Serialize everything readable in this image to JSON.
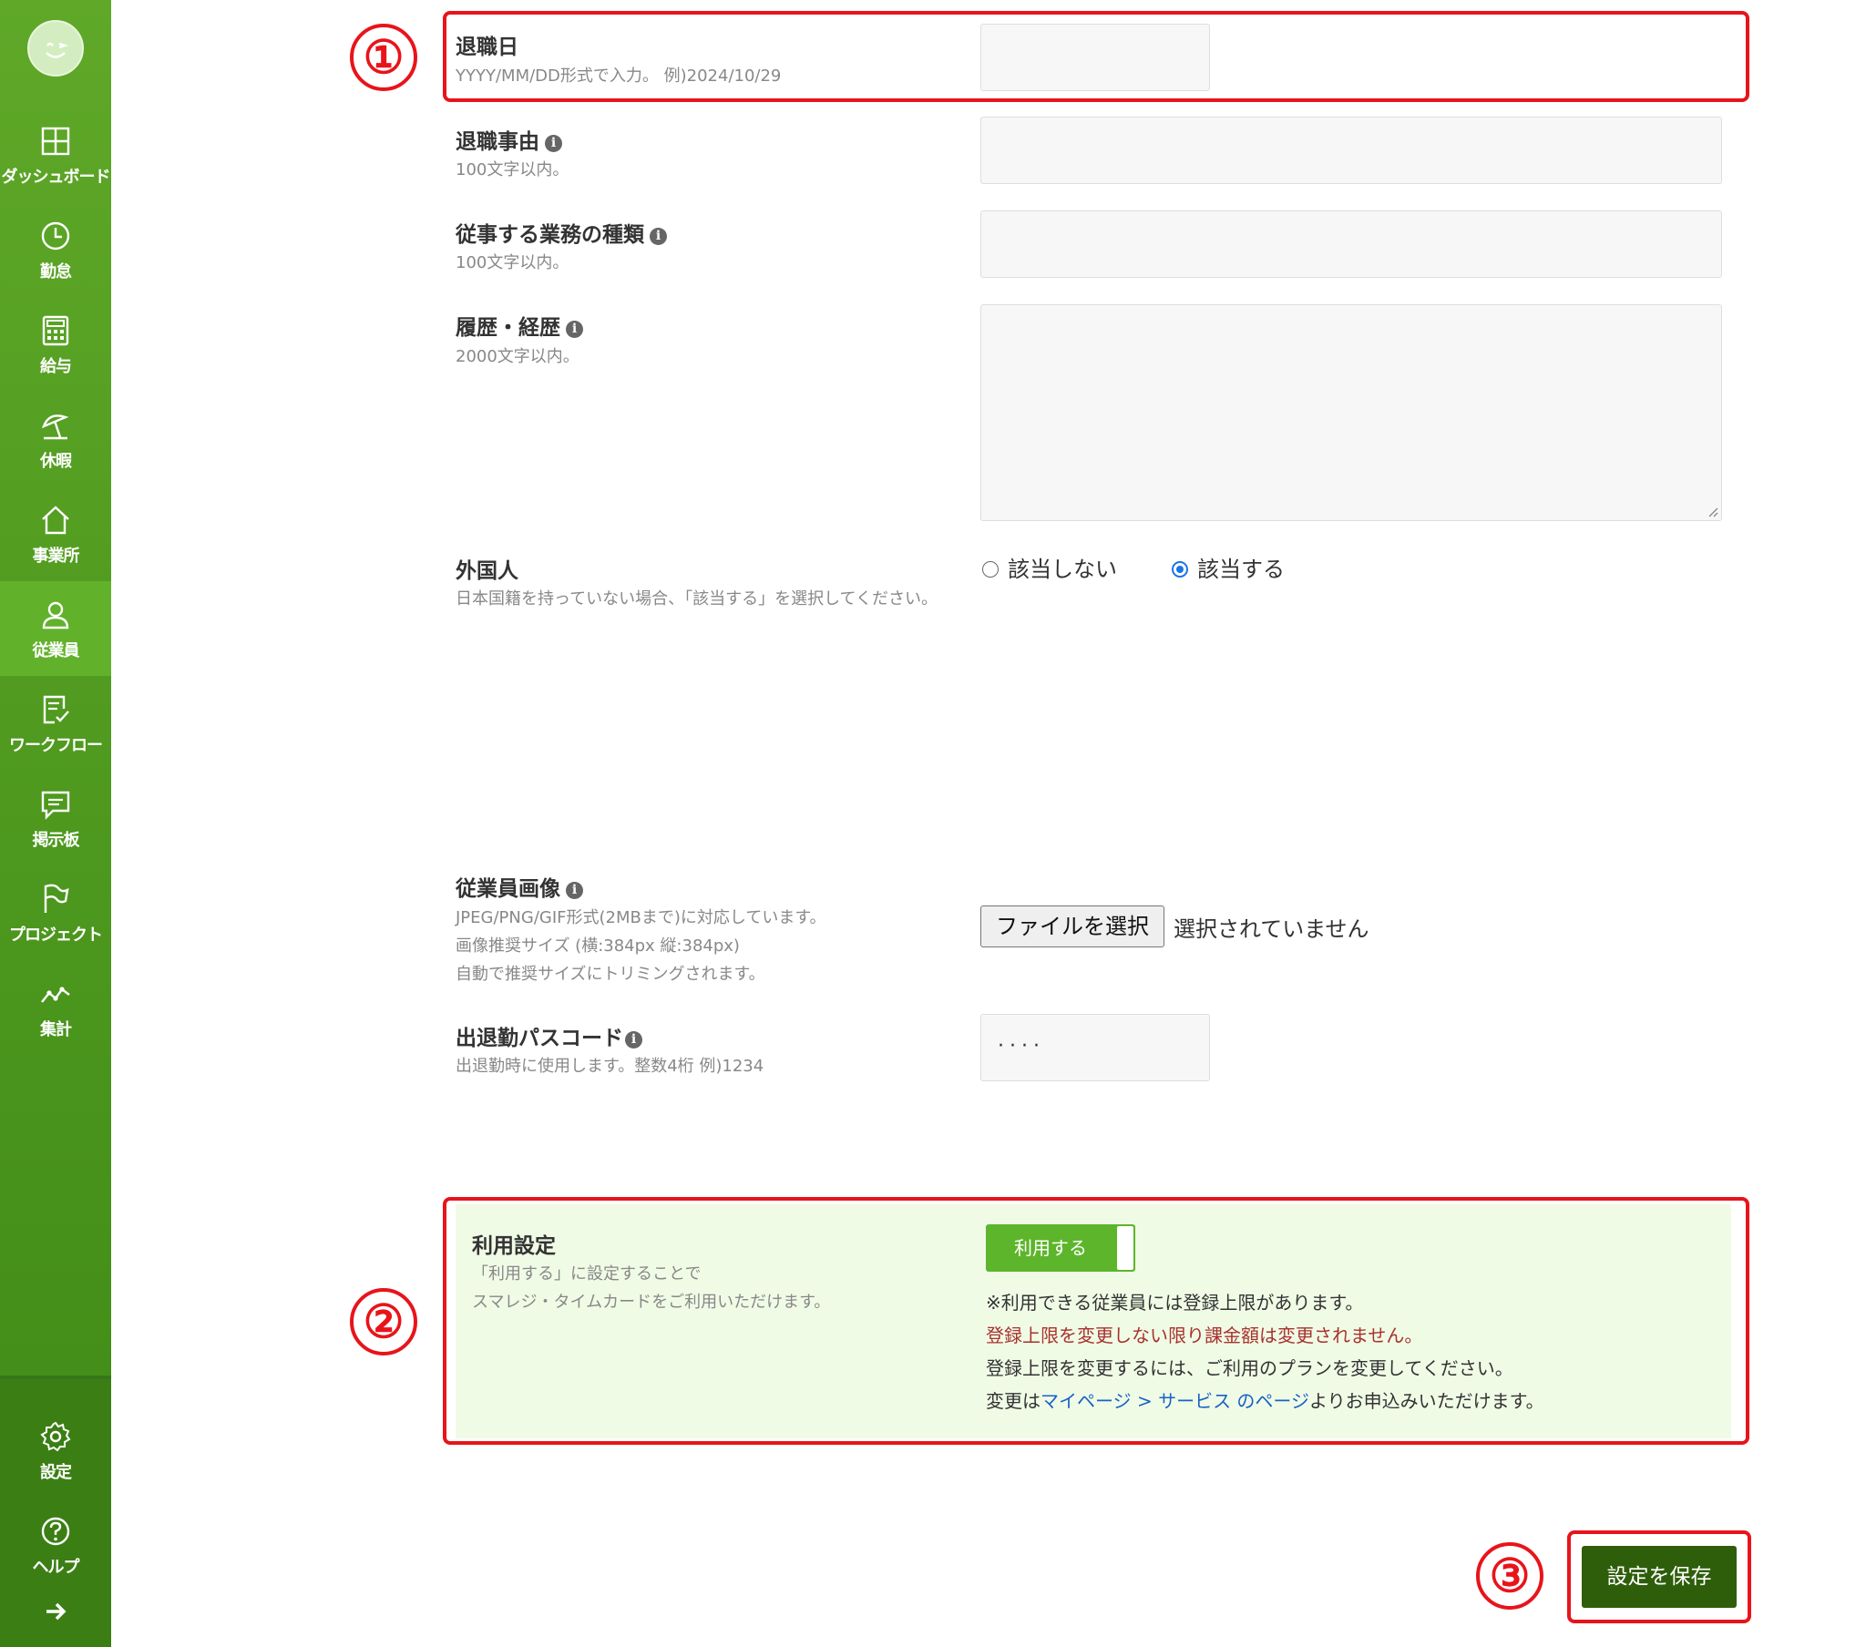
{
  "sidebar": {
    "items": [
      {
        "label": "ダッシュボード",
        "icon": "dashboard-icon"
      },
      {
        "label": "勤怠",
        "icon": "clock-icon"
      },
      {
        "label": "給与",
        "icon": "calculator-icon"
      },
      {
        "label": "休暇",
        "icon": "beach-umbrella-icon"
      },
      {
        "label": "事業所",
        "icon": "home-icon"
      },
      {
        "label": "従業員",
        "icon": "user-icon"
      },
      {
        "label": "ワークフロー",
        "icon": "checklist-icon"
      },
      {
        "label": "掲示板",
        "icon": "message-icon"
      },
      {
        "label": "プロジェクト",
        "icon": "flag-icon"
      },
      {
        "label": "集計",
        "icon": "line-chart-icon"
      }
    ],
    "active": "従業員",
    "bottom": [
      {
        "label": "設定",
        "icon": "gear-icon"
      },
      {
        "label": "ヘルプ",
        "icon": "question-icon"
      }
    ],
    "collapse_icon": "arrow-right-icon"
  },
  "form": {
    "retire_date": {
      "label": "退職日",
      "hint": "YYYY/MM/DD形式で入力。 例)2024/10/29",
      "value": ""
    },
    "retire_reason": {
      "label": "退職事由",
      "hint": "100文字以内。",
      "value": ""
    },
    "job_type": {
      "label": "従事する業務の種類",
      "hint": "100文字以内。",
      "value": ""
    },
    "career": {
      "label": "履歴・経歴",
      "hint": "2000文字以内。",
      "value": ""
    },
    "foreigner": {
      "label": "外国人",
      "hint": "日本国籍を持っていない場合、「該当する」を選択してください。",
      "options": [
        "該当しない",
        "該当する"
      ],
      "selected": "該当する"
    },
    "photo": {
      "label": "従業員画像",
      "hint_lines": [
        "JPEG/PNG/GIF形式(2MBまで)に対応しています。",
        "画像推奨サイズ (横:384px 縦:384px)",
        "自動で推奨サイズにトリミングされます。"
      ],
      "button": "ファイルを選択",
      "status": "選択されていません"
    },
    "passcode": {
      "label": "出退勤パスコード",
      "hint": "出退勤時に使用します。整数4桁 例)1234",
      "value": "····"
    }
  },
  "usage": {
    "label": "利用設定",
    "hint_lines": [
      "「利用する」に設定することで",
      "スマレジ・タイムカードをご利用いただけます。"
    ],
    "toggle_label": "利用する",
    "notes": {
      "n1": "※利用できる従業員には登録上限があります。",
      "n2": "登録上限を変更しない限り課金額は変更されません。",
      "n3": "登録上限を変更するには、ご利用のプランを変更してください。",
      "n4_prefix": "変更は",
      "n4_link": "マイページ > サービス のページ",
      "n4_suffix": "よりお申込みいただけます。"
    }
  },
  "save_button": "設定を保存",
  "annotations": {
    "a1": "①",
    "a2": "②",
    "a3": "③"
  },
  "colors": {
    "brand_green": "#4f9a1f",
    "save_dark": "#2f5e0b",
    "annotation_red": "#e8141b",
    "link": "#1762c4"
  }
}
